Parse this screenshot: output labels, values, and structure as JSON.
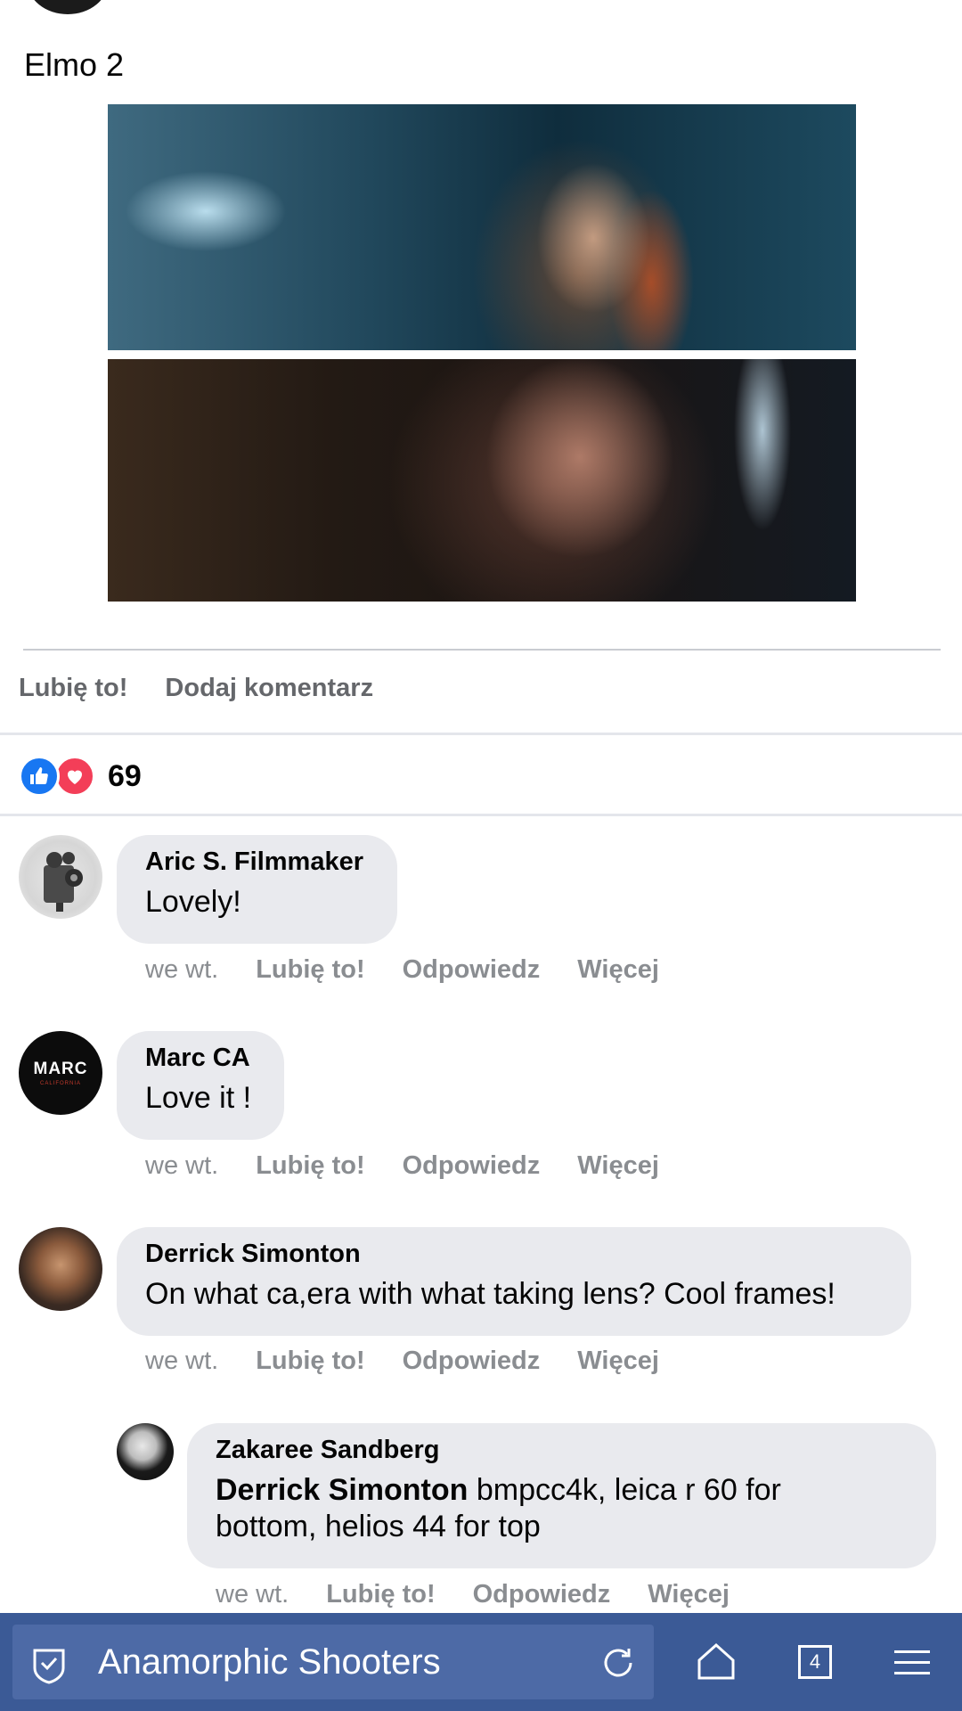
{
  "post": {
    "text": "Elmo 2",
    "actions": {
      "like": "Lubię to!",
      "comment": "Dodaj komentarz"
    },
    "reactions": {
      "count": "69",
      "icons": [
        "like-icon",
        "love-icon"
      ]
    }
  },
  "comments": [
    {
      "name": "Aric S. Filmmaker",
      "text": "Lovely!",
      "meta": {
        "time": "we wt.",
        "like": "Lubię to!",
        "reply": "Odpowiedz",
        "more": "Więcej"
      }
    },
    {
      "name": "Marc CA",
      "avatar_text": "MARC",
      "avatar_subtext": "CALIFORNIA",
      "text": "Love it !",
      "meta": {
        "time": "we wt.",
        "like": "Lubię to!",
        "reply": "Odpowiedz",
        "more": "Więcej"
      }
    },
    {
      "name": "Derrick Simonton",
      "text": "On what ca,era with what taking lens? Cool frames!",
      "meta": {
        "time": "we wt.",
        "like": "Lubię to!",
        "reply": "Odpowiedz",
        "more": "Więcej"
      }
    }
  ],
  "reply": {
    "name": "Zakaree Sandberg",
    "mention": "Derrick Simonton",
    "text_line1": " bmpcc4k, leica r 60 for",
    "text_line2": "bottom, helios 44 for top",
    "meta": {
      "time": "we wt.",
      "like": "Lubię to!",
      "reply": "Odpowiedz",
      "more": "Więcej"
    }
  },
  "browser": {
    "url_text": "Anamorphic Shooters",
    "tab_count": "4",
    "colors": {
      "bar": "#3b5a96",
      "url_box": "#4d6aa6"
    }
  }
}
